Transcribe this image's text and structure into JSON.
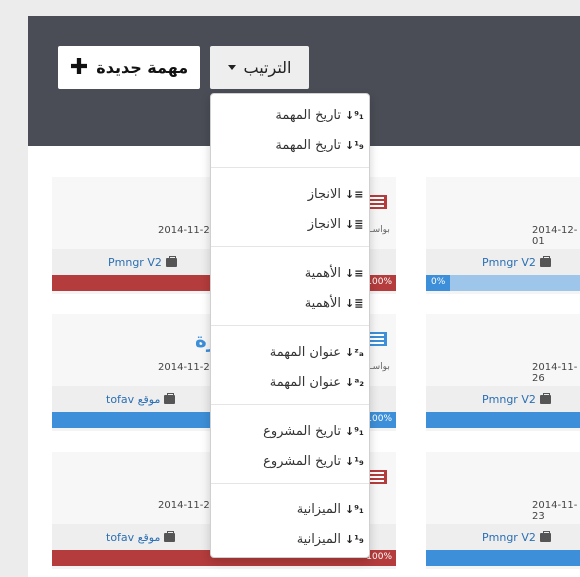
{
  "toolbar": {
    "new_task_label": "مهمة جديدة",
    "new_task_icon": "plus-icon",
    "sort_label": "الترتيب",
    "sort_icon": "caret-down-icon"
  },
  "sort_menu": {
    "groups": [
      {
        "items": [
          {
            "label": "تاريخ المهمة",
            "icon": "sort-numeric-asc-icon",
            "glyph": "↓⁹₁"
          },
          {
            "label": "تاريخ المهمة",
            "icon": "sort-numeric-desc-icon",
            "glyph": "↓¹₉"
          }
        ]
      },
      {
        "items": [
          {
            "label": "الانجاز",
            "icon": "sort-amount-desc-icon",
            "glyph": "↓≡"
          },
          {
            "label": "الانجاز",
            "icon": "sort-amount-asc-icon",
            "glyph": "↓≣"
          }
        ]
      },
      {
        "items": [
          {
            "label": "الأهمية",
            "icon": "sort-amount-desc-icon",
            "glyph": "↓≡"
          },
          {
            "label": "الأهمية",
            "icon": "sort-amount-asc-icon",
            "glyph": "↓≣"
          }
        ]
      },
      {
        "items": [
          {
            "label": "عنوان المهمة",
            "icon": "sort-alpha-desc-icon",
            "glyph": "↓ᶻₐ"
          },
          {
            "label": "عنوان المهمة",
            "icon": "sort-alpha-asc-icon",
            "glyph": "↓ᵃ₂"
          }
        ]
      },
      {
        "items": [
          {
            "label": "تاريخ المشروع",
            "icon": "sort-numeric-asc-icon",
            "glyph": "↓⁹₁"
          },
          {
            "label": "تاريخ المشروع",
            "icon": "sort-numeric-desc-icon",
            "glyph": "↓¹₉"
          }
        ]
      },
      {
        "items": [
          {
            "label": "الميزانية",
            "icon": "sort-numeric-asc-icon",
            "glyph": "↓⁹₁"
          },
          {
            "label": "الميزانية",
            "icon": "sort-numeric-desc-icon",
            "glyph": "↓¹₉"
          }
        ]
      }
    ]
  },
  "cards": [
    {
      "date": "2014-11-28",
      "project": "Pmngr V2",
      "progress_label": "100%",
      "progress": 1.0,
      "bar_color": "#b43c3c",
      "flag_color": "#b43c3c",
      "by": "بواسـ",
      "title": ""
    },
    {
      "date": "2014-12-01",
      "project": "Pmngr V2",
      "progress_label": "0%",
      "progress": 0.0,
      "bar_color": "#9ec5ea",
      "flag_color": "",
      "by": "",
      "title": ""
    },
    {
      "date": "2014-11-25",
      "project": "tofav موقع",
      "progress_label": "100%",
      "progress": 1.0,
      "bar_color": "#3c8fd8",
      "flag_color": "#3c8fd8",
      "by": "بواسـ",
      "title": "رة"
    },
    {
      "date": "2014-11-26",
      "project": "Pmngr V2",
      "progress_label": "",
      "progress": 1.0,
      "bar_color": "#3c8fd8",
      "flag_color": "",
      "by": "",
      "title": ""
    },
    {
      "date": "2014-11-23",
      "project": "tofav موقع",
      "progress_label": "100%",
      "progress": 1.0,
      "bar_color": "#b43c3c",
      "flag_color": "#b43c3c",
      "by": "",
      "title": ""
    },
    {
      "date": "2014-11-23",
      "project": "Pmngr V2",
      "progress_label": "",
      "progress": 1.0,
      "bar_color": "#3c8fd8",
      "flag_color": "",
      "by": "",
      "title": ""
    }
  ]
}
